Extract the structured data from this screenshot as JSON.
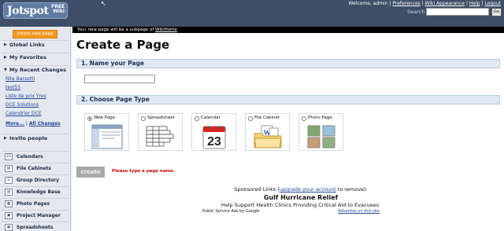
{
  "header": {
    "logo_text": "Jotspot",
    "logo_badge_line1": "FREE",
    "logo_badge_line2": "Wiki",
    "welcome": "Welcome, admin |",
    "links": [
      "Preferences",
      "Wiki Appearance",
      "Help",
      "Logout"
    ],
    "search_label": "Search",
    "search_value": "",
    "search_go": "Go"
  },
  "sidebar": {
    "new_page_button": "create new page",
    "sections": {
      "global_links": "Global Links",
      "my_favorites": "My Favorites",
      "my_recent_changes": "My Recent Changes",
      "invite_people": "Invite people"
    },
    "recent_changes": [
      "fête Barsetti",
      "test55",
      "Liste de prix Yres",
      "DCE Solutions",
      "Calendrier DCE"
    ],
    "more_label": "More...",
    "all_changes_label": "All Changes",
    "tools": [
      {
        "label": "Calendars",
        "icon": "calendar-icon",
        "glyph": "23"
      },
      {
        "label": "File Cabinets",
        "icon": "file-cabinet-icon",
        "glyph": "▤"
      },
      {
        "label": "Group Directory",
        "icon": "group-directory-icon",
        "glyph": "☰"
      },
      {
        "label": "Knowledge Base",
        "icon": "knowledge-base-icon",
        "glyph": "▥"
      },
      {
        "label": "Photo Pages",
        "icon": "photo-icon",
        "glyph": "▦"
      },
      {
        "label": "Project Manager",
        "icon": "project-manager-icon",
        "glyph": "▣"
      },
      {
        "label": "Spreadsheets",
        "icon": "spreadsheet-icon",
        "glyph": "▦"
      }
    ]
  },
  "main": {
    "notice_prefix": "Your new page will be a subpage of",
    "notice_link": "WikiHome",
    "title": "Create a Page",
    "step1": "1. Name your Page",
    "page_name_value": "",
    "step2": "2. Choose Page Type",
    "page_types": [
      {
        "label": "Web Page",
        "selected": true,
        "icon": "web-page-icon"
      },
      {
        "label": "Spreadsheet",
        "selected": false,
        "icon": "spreadsheet-icon"
      },
      {
        "label": "Calendar",
        "selected": false,
        "icon": "calendar-icon",
        "day": "23"
      },
      {
        "label": "File Cabinet",
        "selected": false,
        "icon": "file-cabinet-icon"
      },
      {
        "label": "Photo Page",
        "selected": false,
        "icon": "photo-page-icon"
      }
    ],
    "create_button": "create",
    "error": "Please type a page name."
  },
  "ads": {
    "label_prefix": "Sponsored Links (",
    "label_link": "upgrade your account",
    "label_suffix": " to remove):",
    "title": "Gulf Hurricane Relief",
    "description": "Help Support Health Clinics Providing Critical Aid to Evacuees.",
    "footer_left": "Public Service Ads by Google",
    "footer_right": "Advertise on this site"
  },
  "colors": {
    "header_bg": "#3d4e66",
    "accent_orange": "#f59a21",
    "section_bar": "#dfe8f3",
    "error_red": "#cc0000",
    "link_blue": "#23449a"
  }
}
